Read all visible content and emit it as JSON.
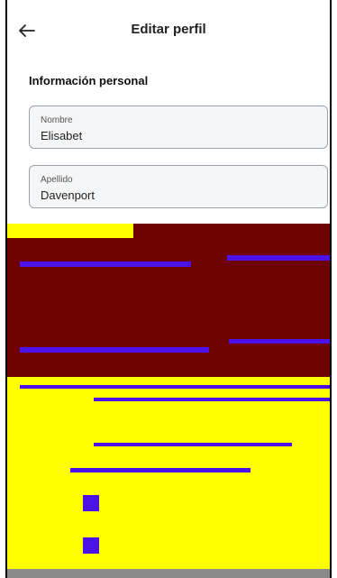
{
  "header": {
    "title": "Editar perfil",
    "back_icon": "arrow-left-icon"
  },
  "section": {
    "title": "Información personal"
  },
  "fields": [
    {
      "label": "Nombre",
      "value": "Elisabet"
    },
    {
      "label": "Apellido",
      "value": "Davenport"
    }
  ],
  "colors": {
    "corruption_red": "#6e0000",
    "corruption_yellow": "#ffff00",
    "corruption_blue": "#4b12e8"
  }
}
